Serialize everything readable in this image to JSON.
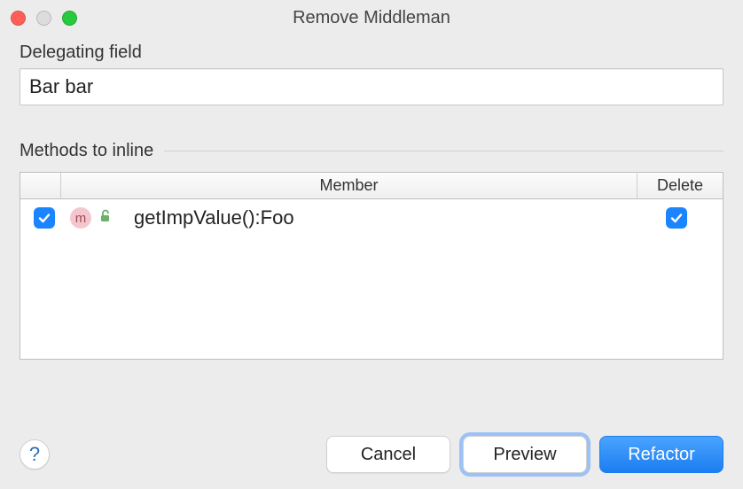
{
  "window": {
    "title": "Remove Middleman"
  },
  "delegating": {
    "label": "Delegating field",
    "value": "Bar bar"
  },
  "methods": {
    "label": "Methods to inline",
    "columns": {
      "member": "Member",
      "delete": "Delete"
    },
    "rows": [
      {
        "selected": true,
        "kind": "m",
        "name": "getImpValue():Foo",
        "delete": true
      }
    ]
  },
  "buttons": {
    "help": "?",
    "cancel": "Cancel",
    "preview": "Preview",
    "refactor": "Refactor"
  }
}
